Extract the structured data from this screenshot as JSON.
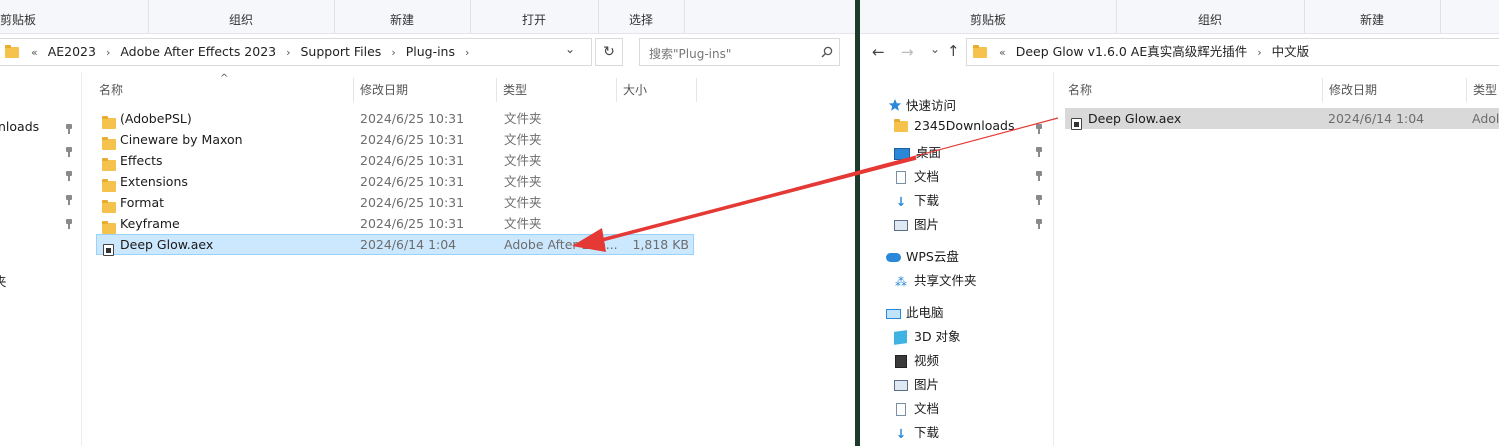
{
  "left": {
    "ribbon": {
      "clipboard": "剪贴板",
      "organize": "组织",
      "new": "新建",
      "open": "打开",
      "select": "选择"
    },
    "breadcrumb": [
      "AE2023",
      "Adobe After Effects 2023",
      "Support Files",
      "Plug-ins"
    ],
    "crumb_prefix": "«",
    "search_placeholder": "搜索\"Plug-ins\"",
    "columns": {
      "name": "名称",
      "date": "修改日期",
      "type": "类型",
      "size": "大小"
    },
    "nav_items": [
      "nloads",
      "夹"
    ],
    "files": [
      {
        "name": "(AdobePSL)",
        "date": "2024/6/25 10:31",
        "type": "文件夹",
        "size": "",
        "kind": "folder"
      },
      {
        "name": "Cineware by Maxon",
        "date": "2024/6/25 10:31",
        "type": "文件夹",
        "size": "",
        "kind": "folder"
      },
      {
        "name": "Effects",
        "date": "2024/6/25 10:31",
        "type": "文件夹",
        "size": "",
        "kind": "folder"
      },
      {
        "name": "Extensions",
        "date": "2024/6/25 10:31",
        "type": "文件夹",
        "size": "",
        "kind": "folder"
      },
      {
        "name": "Format",
        "date": "2024/6/25 10:31",
        "type": "文件夹",
        "size": "",
        "kind": "folder"
      },
      {
        "name": "Keyframe",
        "date": "2024/6/25 10:31",
        "type": "文件夹",
        "size": "",
        "kind": "folder"
      },
      {
        "name": "Deep Glow.aex",
        "date": "2024/6/14 1:04",
        "type": "Adobe After Effe...",
        "size": "1,818 KB",
        "kind": "aex"
      }
    ]
  },
  "right": {
    "ribbon": {
      "clipboard": "剪贴板",
      "organize": "组织",
      "new": "新建"
    },
    "breadcrumb": [
      "Deep Glow v1.6.0 AE真实高级辉光插件",
      "中文版"
    ],
    "crumb_prefix": "«",
    "columns": {
      "name": "名称",
      "date": "修改日期",
      "type": "类型"
    },
    "quick_access": "快速访问",
    "quick_items": [
      {
        "label": "2345Downloads",
        "icon": "folder-icon"
      },
      {
        "label": "桌面",
        "icon": "desktop-icon"
      },
      {
        "label": "文档",
        "icon": "document-icon"
      },
      {
        "label": "下载",
        "icon": "download-icon"
      },
      {
        "label": "图片",
        "icon": "picture-icon"
      }
    ],
    "wps": "WPS云盘",
    "shared": "共享文件夹",
    "this_pc": "此电脑",
    "pc_items": [
      {
        "label": "3D 对象",
        "icon": "3d-objects-icon"
      },
      {
        "label": "视频",
        "icon": "video-icon"
      },
      {
        "label": "图片",
        "icon": "picture-icon"
      },
      {
        "label": "文档",
        "icon": "document-icon"
      },
      {
        "label": "下载",
        "icon": "download-icon"
      }
    ],
    "files": [
      {
        "name": "Deep Glow.aex",
        "date": "2024/6/14 1:04",
        "type": "Adol"
      }
    ]
  },
  "colors": {
    "accent": "#0078d4",
    "selection": "#cce8ff",
    "arrow": "#e53935"
  }
}
